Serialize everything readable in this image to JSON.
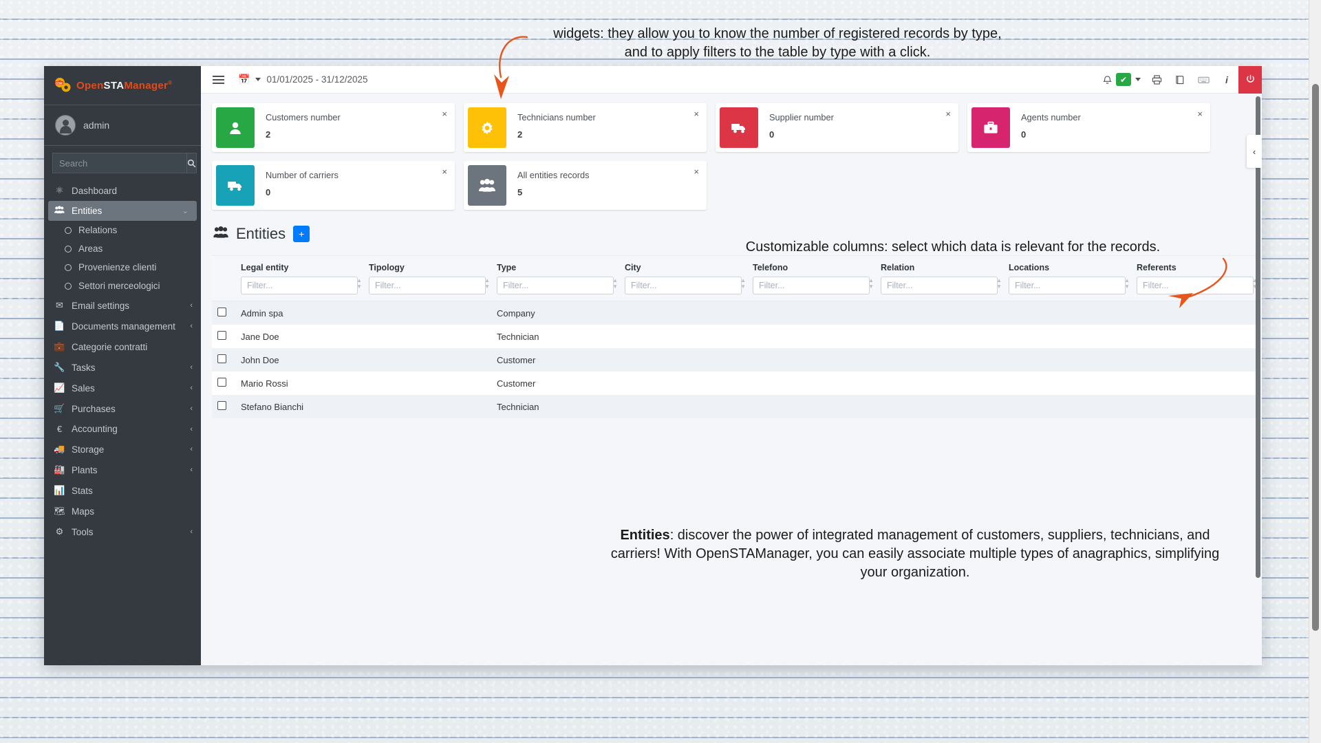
{
  "sidebar": {
    "brand": {
      "text_open": "Open",
      "text_sta": "STA",
      "text_manager": "Manager",
      "reg": "®"
    },
    "user": {
      "name": "admin",
      "avatar_icon": "user-avatar-icon"
    },
    "search": {
      "placeholder": "Search",
      "button_icon": "search-icon"
    },
    "items": [
      {
        "label": "Dashboard",
        "icon": "dashboard-icon",
        "type": "link",
        "active": false,
        "chevron": ""
      },
      {
        "label": "Entities",
        "icon": "users-icon",
        "type": "link",
        "active": true,
        "chevron": "⌄"
      },
      {
        "label": "Relations",
        "icon": "circle-icon",
        "type": "sub"
      },
      {
        "label": "Areas",
        "icon": "circle-icon",
        "type": "sub"
      },
      {
        "label": "Provenienze clienti",
        "icon": "circle-icon",
        "type": "sub"
      },
      {
        "label": "Settori merceologici",
        "icon": "circle-icon",
        "type": "sub"
      },
      {
        "label": "Email settings",
        "icon": "envelope-icon",
        "type": "link",
        "chevron": "‹"
      },
      {
        "label": "Documents management",
        "icon": "file-icon",
        "type": "link",
        "chevron": "‹"
      },
      {
        "label": "Categorie contratti",
        "icon": "briefcase-icon",
        "type": "link",
        "chevron": ""
      },
      {
        "label": "Tasks",
        "icon": "wrench-icon",
        "type": "link",
        "chevron": "‹"
      },
      {
        "label": "Sales",
        "icon": "chart-line-icon",
        "type": "link",
        "chevron": "‹"
      },
      {
        "label": "Purchases",
        "icon": "cart-icon",
        "type": "link",
        "chevron": "‹"
      },
      {
        "label": "Accounting",
        "icon": "euro-icon",
        "type": "link",
        "chevron": "‹"
      },
      {
        "label": "Storage",
        "icon": "truck-icon",
        "type": "link",
        "chevron": "‹"
      },
      {
        "label": "Plants",
        "icon": "factory-icon",
        "type": "link",
        "chevron": "‹"
      },
      {
        "label": "Stats",
        "icon": "bar-chart-icon",
        "type": "link",
        "chevron": ""
      },
      {
        "label": "Maps",
        "icon": "map-icon",
        "type": "link",
        "chevron": ""
      },
      {
        "label": "Tools",
        "icon": "gear-icon",
        "type": "link",
        "chevron": "‹"
      }
    ]
  },
  "topbar": {
    "menu_icon": "hamburger-icon",
    "calendar_icon": "calendar-icon",
    "date_range": "01/01/2025 - 31/12/2025",
    "icons": [
      {
        "name": "bell-icon",
        "glyph": "🔔"
      },
      {
        "name": "check-badge",
        "glyph": "✔"
      },
      {
        "name": "printer-icon",
        "glyph": "⎙"
      },
      {
        "name": "book-icon",
        "glyph": "📕"
      },
      {
        "name": "keyboard-icon",
        "glyph": "⌨"
      },
      {
        "name": "info-icon",
        "glyph": "i"
      },
      {
        "name": "power-icon",
        "glyph": "⏻"
      }
    ]
  },
  "widgets": [
    {
      "title": "Customers number",
      "value": "2",
      "color": "#28a745",
      "icon": "user-icon",
      "close": "×"
    },
    {
      "title": "Technicians number",
      "value": "2",
      "color": "#ffc107",
      "icon": "gear-icon",
      "close": "×"
    },
    {
      "title": "Supplier number",
      "value": "0",
      "color": "#dc3545",
      "icon": "truck-icon",
      "close": "×"
    },
    {
      "title": "Agents number",
      "value": "0",
      "color": "#d6246e",
      "icon": "briefcase-icon",
      "close": "×"
    },
    {
      "title": "Number of carriers",
      "value": "0",
      "color": "#17a2b8",
      "icon": "truck-icon",
      "close": "×"
    },
    {
      "title": "All entities records",
      "value": "5",
      "color": "#6c757d",
      "icon": "users-icon",
      "close": "×"
    }
  ],
  "section": {
    "icon": "users-icon",
    "title": "Entities",
    "add_label": "+"
  },
  "table": {
    "filter_placeholder": "Filter...",
    "columns": [
      "Legal entity",
      "Tipology",
      "Type",
      "City",
      "Telefono",
      "Relation",
      "Locations",
      "Referents"
    ],
    "rows": [
      {
        "legal_entity": "Admin spa",
        "tipology": "",
        "type": "Company",
        "city": "",
        "telefono": "",
        "relation": "",
        "locations": "",
        "referents": ""
      },
      {
        "legal_entity": "Jane Doe",
        "tipology": "",
        "type": "Technician",
        "city": "",
        "telefono": "",
        "relation": "",
        "locations": "",
        "referents": ""
      },
      {
        "legal_entity": "John Doe",
        "tipology": "",
        "type": "Customer",
        "city": "",
        "telefono": "",
        "relation": "",
        "locations": "",
        "referents": ""
      },
      {
        "legal_entity": "Mario Rossi",
        "tipology": "",
        "type": "Customer",
        "city": "",
        "telefono": "",
        "relation": "",
        "locations": "",
        "referents": ""
      },
      {
        "legal_entity": "Stefano Bianchi",
        "tipology": "",
        "type": "Technician",
        "city": "",
        "telefono": "",
        "relation": "",
        "locations": "",
        "referents": ""
      }
    ]
  },
  "collapse_tab": {
    "icon": "chevron-left-icon",
    "glyph": "‹"
  },
  "annotations": {
    "widgets_note": "widgets: they allow you to know the number of registered records by type, and to apply filters to the table by type with a click.",
    "columns_note": "Customizable columns: select which data is relevant for the records.",
    "entities_note_bold": "Entities",
    "entities_note_rest": ": discover the power of integrated management of customers, suppliers, technicians, and carriers! With OpenSTAManager, you can easily associate multiple types of anagraphics, simplifying your organization."
  },
  "colors": {
    "sidebar_bg": "#343a40",
    "accent_blue": "#007bff",
    "brand_orange": "#e64a19",
    "annotation_arrow": "#e8551b"
  }
}
